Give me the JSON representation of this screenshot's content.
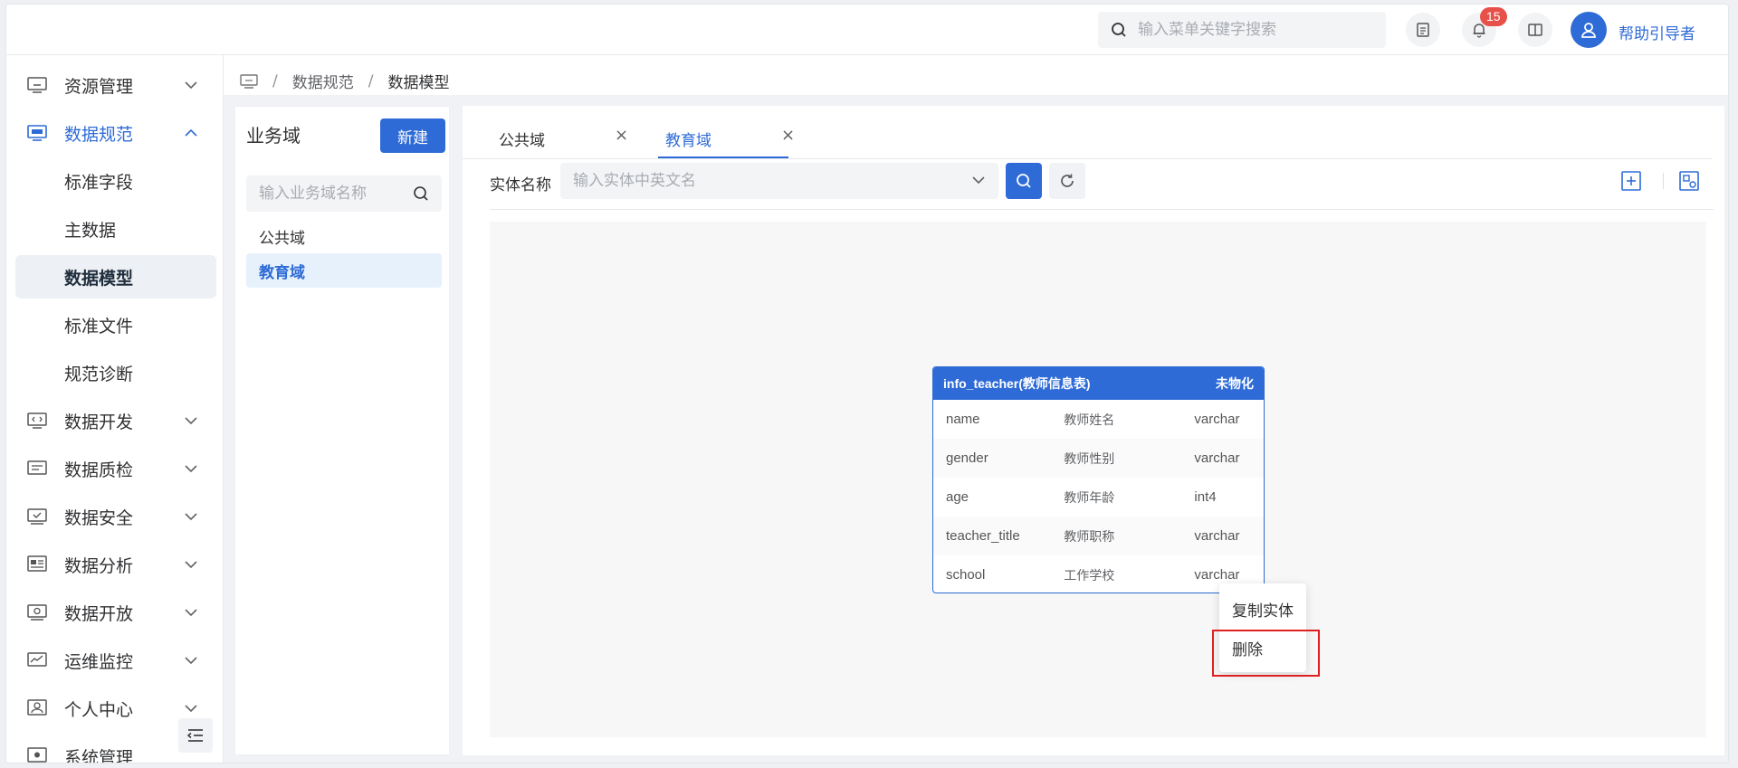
{
  "header": {
    "search_placeholder": "输入菜单关键字搜索",
    "notification_count": "15",
    "user_name": "帮助引导者"
  },
  "sidebar": {
    "items": [
      {
        "label": "资源管理",
        "icon": "monitor-icon"
      },
      {
        "label": "数据规范",
        "icon": "monitor-icon"
      },
      {
        "label": "数据开发",
        "icon": "code-icon"
      },
      {
        "label": "数据质检",
        "icon": "list-icon"
      },
      {
        "label": "数据安全",
        "icon": "check-screen-icon"
      },
      {
        "label": "数据分析",
        "icon": "dashboard-icon"
      },
      {
        "label": "数据开放",
        "icon": "share-screen-icon"
      },
      {
        "label": "运维监控",
        "icon": "chart-icon"
      },
      {
        "label": "个人中心",
        "icon": "person-icon"
      },
      {
        "label": "系统管理",
        "icon": "gear-screen-icon"
      }
    ],
    "sub_items": [
      "标准字段",
      "主数据",
      "数据模型",
      "标准文件",
      "规范诊断"
    ],
    "selected_sub": "数据模型"
  },
  "breadcrumb": {
    "items": [
      "数据规范",
      "数据模型"
    ],
    "separator": "/"
  },
  "domain_panel": {
    "title": "业务域",
    "new_button": "新建",
    "search_placeholder": "输入业务域名称",
    "domains": [
      "公共域",
      "教育域"
    ],
    "selected": "教育域"
  },
  "tabs": [
    {
      "label": "公共域",
      "close": "×"
    },
    {
      "label": "教育域",
      "close": "×"
    }
  ],
  "filter": {
    "label": "实体名称",
    "placeholder": "输入实体中英文名"
  },
  "entity": {
    "title": "info_teacher(教师信息表)",
    "status": "未物化",
    "fields": [
      {
        "name": "name",
        "cn": "教师姓名",
        "type": "varchar"
      },
      {
        "name": "gender",
        "cn": "教师性别",
        "type": "varchar"
      },
      {
        "name": "age",
        "cn": "教师年龄",
        "type": "int4"
      },
      {
        "name": "teacher_title",
        "cn": "教师职称",
        "type": "varchar"
      },
      {
        "name": "school",
        "cn": "工作学校",
        "type": "varchar"
      }
    ]
  },
  "context_menu": {
    "copy": "复制实体",
    "delete": "删除"
  },
  "colors": {
    "primary": "#2e6bd6",
    "badge": "#e8504a",
    "highlight": "#e02020"
  }
}
